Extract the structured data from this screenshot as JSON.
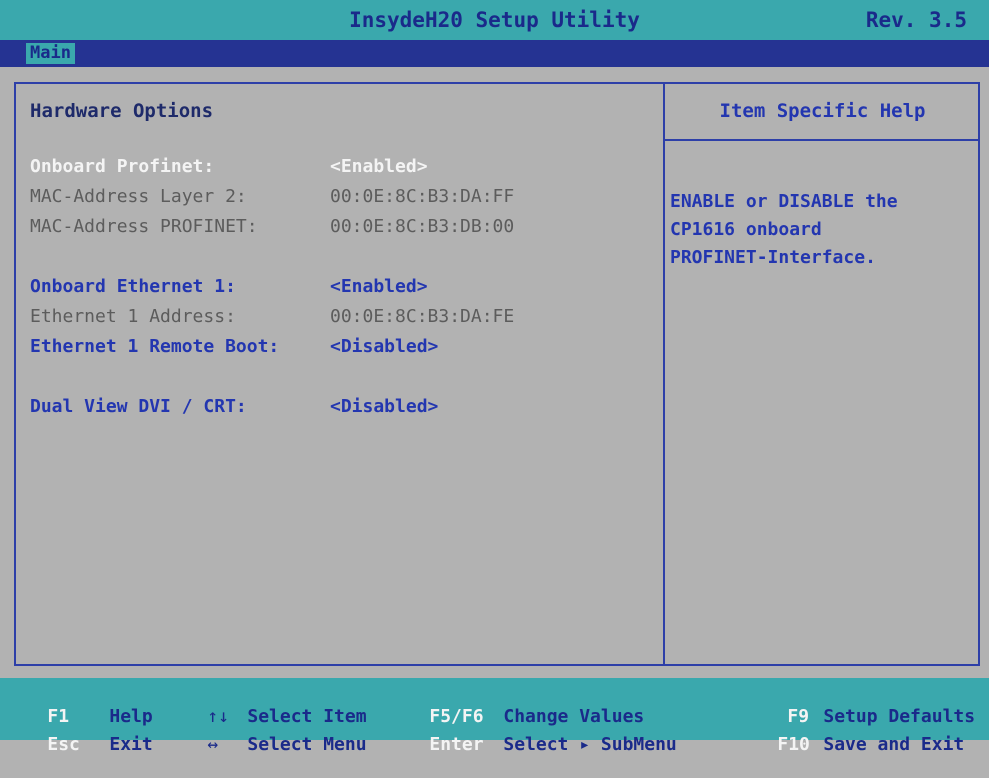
{
  "header": {
    "title": "InsydeH20 Setup Utility",
    "rev": "Rev. 3.5"
  },
  "menu": {
    "tabs": [
      {
        "label": "Main"
      }
    ]
  },
  "main": {
    "section_title": "Hardware Options",
    "rows": [
      {
        "label": "Onboard Profinet:",
        "value": "<Enabled>"
      },
      {
        "label": "MAC-Address Layer 2:",
        "value": "00:0E:8C:B3:DA:FF"
      },
      {
        "label": "MAC-Address PROFINET:",
        "value": "00:0E:8C:B3:DB:00"
      },
      {
        "label": "Onboard Ethernet 1:",
        "value": "<Enabled>"
      },
      {
        "label": "Ethernet 1 Address:",
        "value": "00:0E:8C:B3:DA:FE"
      },
      {
        "label": "Ethernet 1 Remote Boot:",
        "value": "<Disabled>"
      },
      {
        "label": "Dual View DVI / CRT:",
        "value": "<Disabled>"
      }
    ]
  },
  "help": {
    "title": "Item Specific Help",
    "lines": [
      "ENABLE or DISABLE the",
      "CP1616 onboard",
      "PROFINET-Interface."
    ]
  },
  "footer": {
    "f1_key": "F1",
    "f1_desc": "Help",
    "esc_key": "Esc",
    "esc_desc": "Exit",
    "updown_icon": "↑↓",
    "updown_desc": "Select Item",
    "leftright_icon": "↔",
    "leftright_desc": "Select Menu",
    "f5f6_key": "F5/F6",
    "f5f6_desc": "Change Values",
    "enter_key": "Enter",
    "enter_desc": "Select ▸ SubMenu",
    "f9_key": "F9",
    "f9_desc": "Setup Defaults",
    "f10_key": "F10",
    "f10_desc": "Save and Exit"
  },
  "colors": {
    "background": "#b2b2b2",
    "title_bar": "#3aa8ad",
    "menu_bar": "#253392",
    "accent_blue": "#2336b0",
    "highlight_white": "#f4f4f4"
  }
}
